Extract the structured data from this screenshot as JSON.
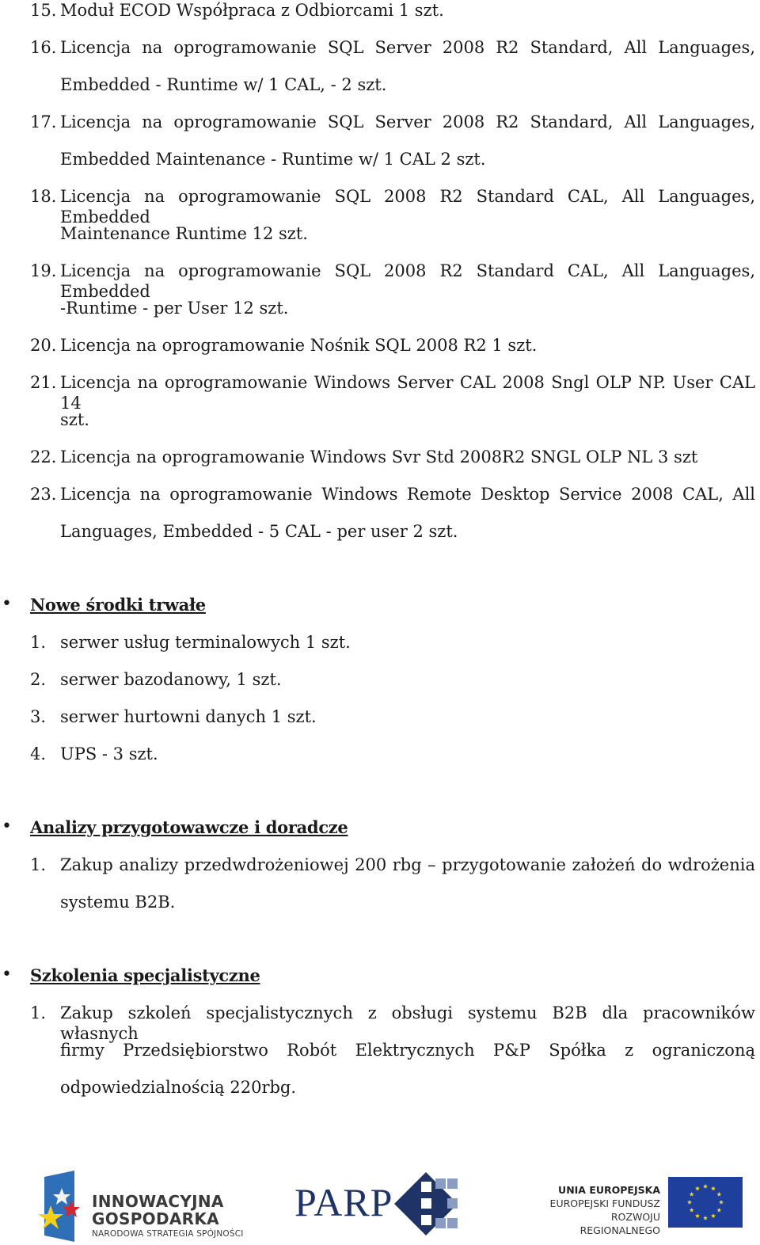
{
  "licenses_list": {
    "items": [
      {
        "num": "15.",
        "lines": [
          "Moduł ECOD Współpraca z Odbiorcami 1 szt."
        ]
      },
      {
        "num": "16.",
        "lines": [
          "Licencja na oprogramowanie SQL Server 2008 R2 Standard, All Languages,",
          "Embedded - Runtime w/ 1 CAL, - 2 szt."
        ]
      },
      {
        "num": "17.",
        "lines": [
          "Licencja na oprogramowanie SQL Server 2008 R2 Standard, All Languages,",
          "Embedded Maintenance - Runtime w/ 1 CAL 2 szt."
        ]
      },
      {
        "num": "18.",
        "lines": [
          "Licencja na oprogramowanie SQL 2008 R2 Standard CAL, All Languages, Embedded",
          "Maintenance Runtime 12 szt."
        ]
      },
      {
        "num": "19.",
        "lines": [
          "Licencja na oprogramowanie SQL 2008 R2 Standard CAL, All Languages, Embedded",
          "-Runtime - per User 12 szt."
        ]
      },
      {
        "num": "20.",
        "lines": [
          "Licencja na oprogramowanie Nośnik SQL 2008 R2 1 szt."
        ]
      },
      {
        "num": "21.",
        "lines": [
          "Licencja na oprogramowanie Windows Server CAL 2008 Sngl OLP NP. User CAL 14",
          "szt."
        ]
      },
      {
        "num": "22.",
        "lines": [
          "Licencja na oprogramowanie Windows Svr Std 2008R2 SNGL OLP NL 3 szt"
        ]
      },
      {
        "num": "23.",
        "lines": [
          "Licencja na oprogramowanie Windows Remote Desktop Service 2008 CAL, All",
          "Languages, Embedded - 5 CAL - per user 2 szt."
        ]
      }
    ]
  },
  "sections": [
    {
      "bullet": "•",
      "heading": "Nowe środki trwałe",
      "items": [
        {
          "num": "1.",
          "lines": [
            "serwer usług terminalowych 1 szt."
          ]
        },
        {
          "num": "2.",
          "lines": [
            "serwer bazodanowy, 1 szt."
          ]
        },
        {
          "num": "3.",
          "lines": [
            "serwer hurtowni danych 1 szt."
          ]
        },
        {
          "num": "4.",
          "lines": [
            "UPS - 3 szt."
          ]
        }
      ]
    },
    {
      "bullet": "•",
      "heading": "Analizy przygotowawcze i doradcze",
      "items": [
        {
          "num": "1.",
          "lines": [
            "Zakup analizy przedwdrożeniowej 200 rbg – przygotowanie założeń do wdrożenia",
            "systemu B2B."
          ]
        }
      ]
    },
    {
      "bullet": "•",
      "heading": "Szkolenia specjalistyczne",
      "items": [
        {
          "num": "1.",
          "lines": [
            "Zakup szkoleń specjalistycznych z obsługi systemu B2B dla pracowników własnych",
            "firmy Przedsiębiorstwo Robót Elektrycznych P&P Spółka z ograniczoną",
            "odpowiedzialnością 220rbg."
          ]
        }
      ]
    }
  ],
  "footer_logos": {
    "innowacyjna_gospodarka": {
      "title_line1": "INNOWACYJNA",
      "title_line2": "GOSPODARKA",
      "subtitle": "NARODOWA STRATEGIA SPÓJNOŚCI"
    },
    "parp": {
      "text": "PARP"
    },
    "unia_europejska": {
      "line1": "UNIA EUROPEJSKA",
      "line2": "EUROPEJSKI FUNDUSZ",
      "line3": "ROZWOJU REGIONALNEGO"
    }
  },
  "colors": {
    "text": "#1a1a1a",
    "parp_navy": "#1f3366",
    "eu_blue": "#1f3f9c",
    "eu_star": "#ffdd00"
  }
}
